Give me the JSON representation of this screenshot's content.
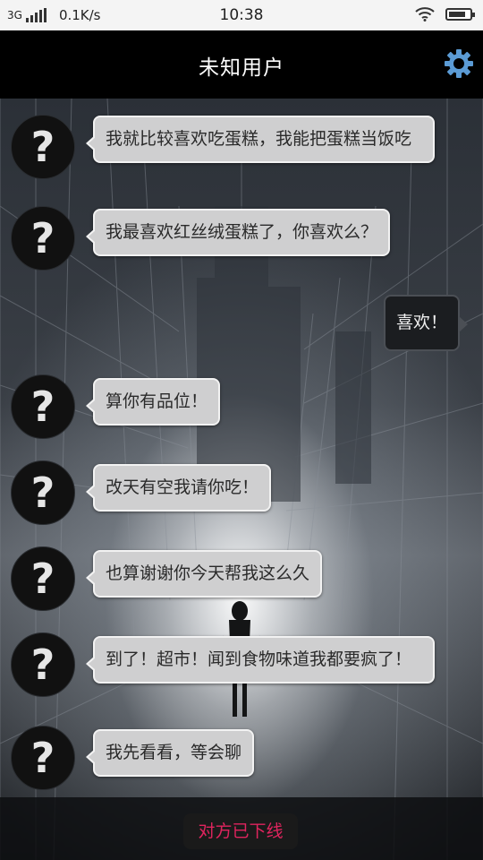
{
  "status_bar": {
    "network": "3G",
    "speed": "0.1K/s",
    "time": "10:38",
    "icons": [
      "signal-icon",
      "wifi-icon",
      "battery-charging-icon"
    ]
  },
  "header": {
    "title": "未知用户",
    "settings_icon": "gear-icon",
    "accent_color": "#5b9bd5"
  },
  "avatar_placeholder": "?",
  "messages": [
    {
      "from": "other",
      "text": "我就比较喜欢吃蛋糕，我能把蛋糕当饭吃"
    },
    {
      "from": "other",
      "text": "我最喜欢红丝绒蛋糕了，你喜欢么？"
    },
    {
      "from": "me",
      "text": "喜欢！"
    },
    {
      "from": "other",
      "text": "算你有品位！"
    },
    {
      "from": "other",
      "text": "改天有空我请你吃！"
    },
    {
      "from": "other",
      "text": "也算谢谢你今天帮我这么久"
    },
    {
      "from": "other",
      "text": "到了！超市！闻到食物味道我都要疯了！"
    },
    {
      "from": "other",
      "text": "我先看看，等会聊"
    }
  ],
  "footer": {
    "status_text": "对方已下线",
    "status_color": "#e0245e"
  }
}
